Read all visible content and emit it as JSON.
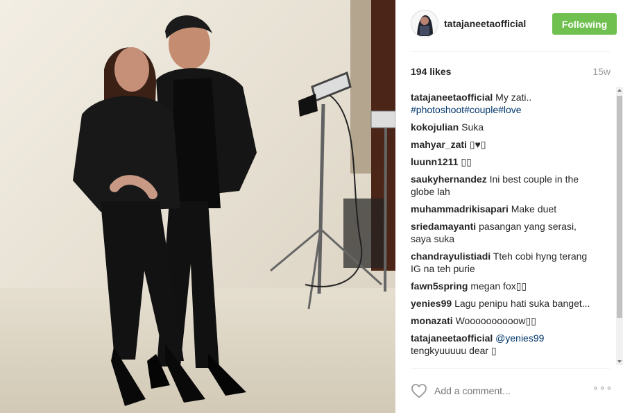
{
  "post": {
    "username": "tatajaneetaofficial",
    "follow_label": "Following",
    "likes": "194 likes",
    "time_ago": "15w"
  },
  "comments": [
    {
      "user": "tatajaneetaofficial",
      "text": "My zati..",
      "hashtags": "#photoshoot#couple#love"
    },
    {
      "user": "kokojulian",
      "text": "Suka"
    },
    {
      "user": "mahyar_zati",
      "text": "▯♥▯"
    },
    {
      "user": "luunn1211",
      "text": "▯▯"
    },
    {
      "user": "saukyhernandez",
      "text": "Ini best couple in the globe lah"
    },
    {
      "user": "muhammadrikisapari",
      "text": "Make duet"
    },
    {
      "user": "sriedamayanti",
      "text": "pasangan yang serasi, saya suka"
    },
    {
      "user": "chandrayulistiadi",
      "text": "Tteh cobi hyng terang IG na teh purie"
    },
    {
      "user": "fawn5spring",
      "text": "megan fox▯▯"
    },
    {
      "user": "yenies99",
      "text": "Lagu penipu hati suka banget..."
    },
    {
      "user": "monazati",
      "text": "Woooooooooow▯▯"
    },
    {
      "user": "tatajaneetaofficial",
      "mention": "@yenies99",
      "text": "tengkyuuuuu dear ▯"
    }
  ],
  "footer": {
    "comment_placeholder": "Add a comment...",
    "more_label": "∘∘∘"
  },
  "icons": {
    "heart": "heart-icon",
    "more": "more-options-icon"
  }
}
